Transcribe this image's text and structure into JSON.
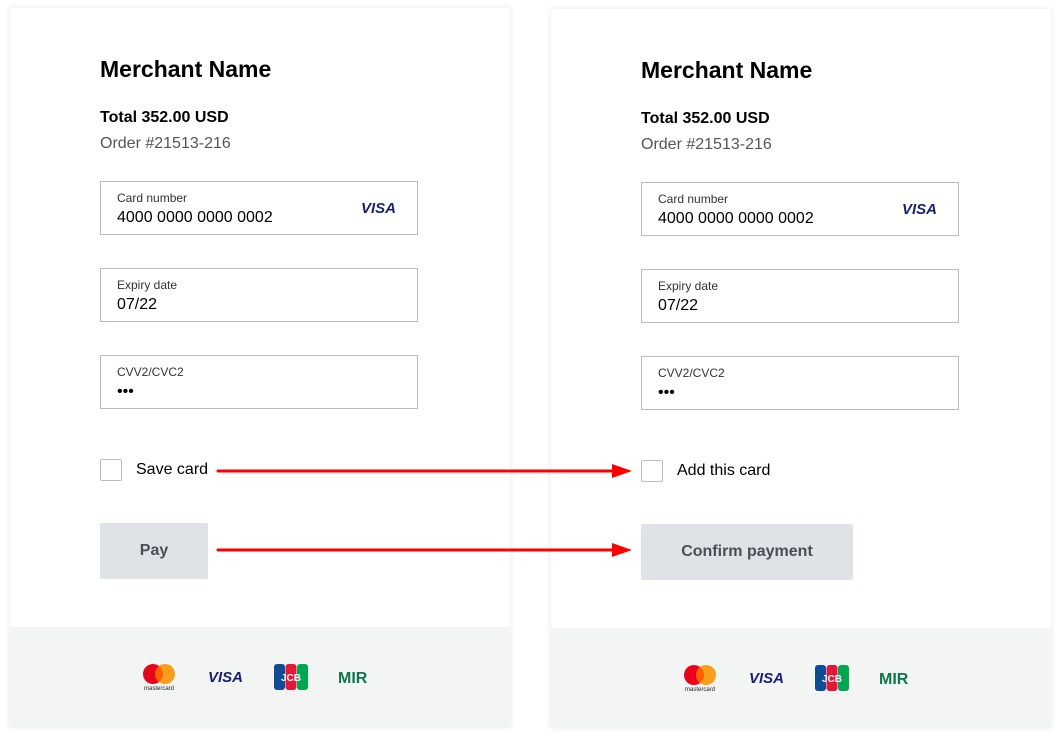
{
  "left": {
    "merchant": "Merchant Name",
    "total": "Total 352.00 USD",
    "order": "Order #21513-216",
    "card_label": "Card number",
    "card_value": "4000 0000 0000 0002",
    "expiry_label": "Expiry date",
    "expiry_value": "07/22",
    "cvv_label": "CVV2/CVC2",
    "cvv_value": "•••",
    "checkbox_label": "Save card",
    "button_label": "Pay"
  },
  "right": {
    "merchant": "Merchant Name",
    "total": "Total 352.00 USD",
    "order": "Order #21513-216",
    "card_label": "Card number",
    "card_value": "4000 0000 0000 0002",
    "expiry_label": "Expiry date",
    "expiry_value": "07/22",
    "cvv_label": "CVV2/CVC2",
    "cvv_value": "•••",
    "checkbox_label": "Add this card",
    "button_label": "Confirm payment"
  },
  "logos": {
    "card_network": "VISA",
    "mastercard": "mastercard",
    "visa": "VISA",
    "jcb": "JCB",
    "mir": "MIR"
  },
  "colors": {
    "arrow": "#ff0000",
    "button_bg": "#dfe2e6",
    "footer_bg": "#f3f5f5",
    "visa_blue": "#1a1f71"
  }
}
